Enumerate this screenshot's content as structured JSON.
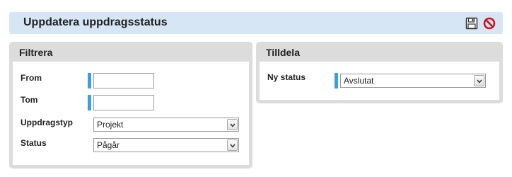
{
  "header": {
    "title": "Uppdatera uppdragsstatus"
  },
  "filter": {
    "title": "Filtrera",
    "from_label": "From",
    "from_value": "",
    "tom_label": "Tom",
    "tom_value": "",
    "type_label": "Uppdragstyp",
    "type_value": "Projekt",
    "status_label": "Status",
    "status_value": "Pågår"
  },
  "assign": {
    "title": "Tilldela",
    "new_status_label": "Ny status",
    "new_status_value": "Avslutat"
  },
  "colors": {
    "header_bg": "#d6e6f5",
    "panel_bg": "#dcdcdc",
    "required_marker": "#3aa0e6",
    "cancel_icon": "#d0141c"
  }
}
